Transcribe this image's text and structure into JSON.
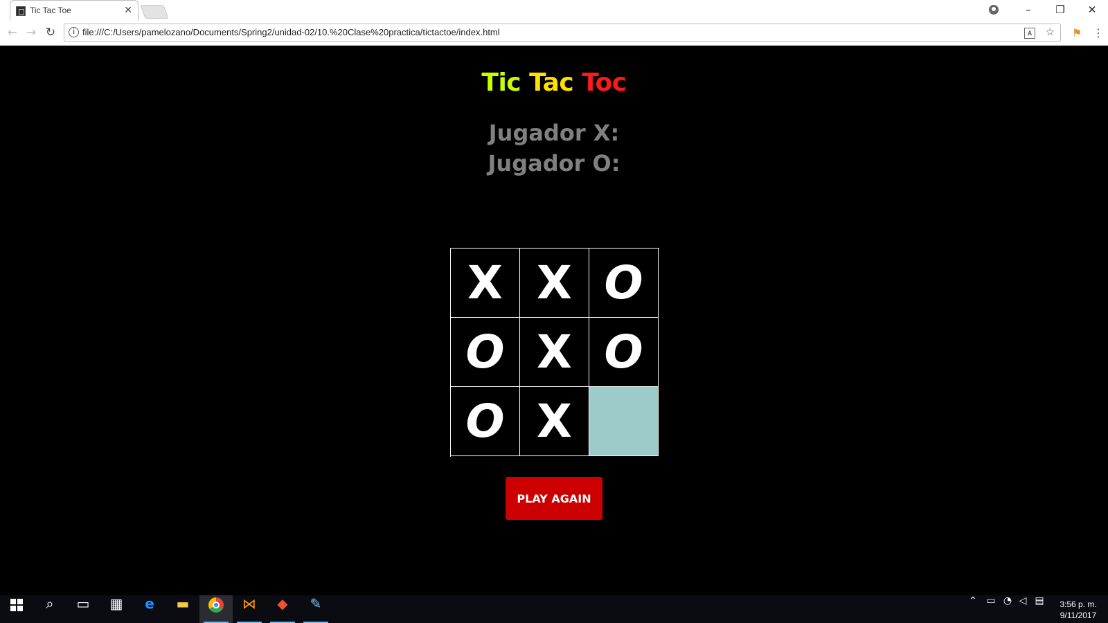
{
  "browser": {
    "tab_title": "Tic Tac Toe",
    "url": "file:///C:/Users/pamelozano/Documents/Spring2/unidad-02/10.%20Clase%20practica/tictactoe/index.html"
  },
  "page": {
    "title_words": [
      "Tic",
      "Tac",
      "Toc"
    ],
    "title_colors": [
      "#c8ff00",
      "#ffe000",
      "#ff1a1a"
    ],
    "player_x_label": "Jugador X:",
    "player_o_label": "Jugador O:",
    "board": [
      [
        "X",
        "X",
        "O"
      ],
      [
        "O",
        "X",
        "O"
      ],
      [
        "O",
        "X",
        ""
      ]
    ],
    "empty_cell_color": "#9ccbca",
    "play_again_label": "PLAY AGAIN",
    "button_color": "#cc0000"
  },
  "taskbar": {
    "icons": [
      "windows-start-icon",
      "search-icon",
      "task-view-icon",
      "store-icon",
      "edge-icon",
      "file-explorer-icon",
      "chrome-icon",
      "sublime-icon",
      "git-icon",
      "paint-icon"
    ],
    "time": "3:56 p. m.",
    "date": "9/11/2017"
  }
}
